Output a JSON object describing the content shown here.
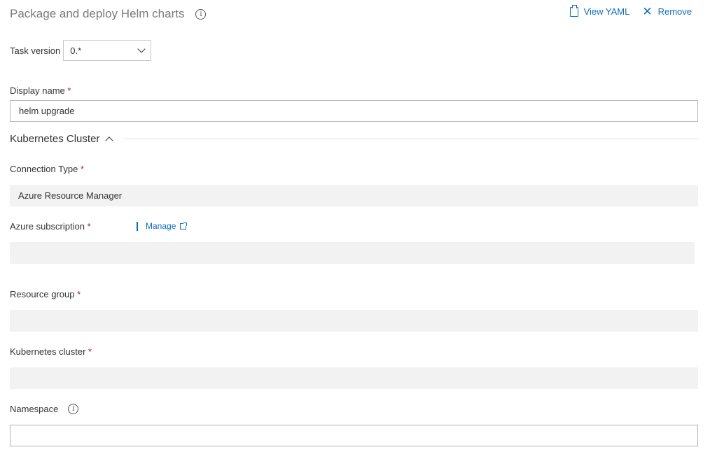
{
  "header": {
    "title": "Package and deploy Helm charts",
    "actions": {
      "view_yaml": "View YAML",
      "remove": "Remove"
    }
  },
  "task_version": {
    "label": "Task version",
    "value": "0.*"
  },
  "display_name": {
    "label": "Display name",
    "required_mark": "*",
    "value": "helm upgrade"
  },
  "kubernetes_section": {
    "title": "Kubernetes Cluster"
  },
  "connection_type": {
    "label": "Connection Type",
    "required_mark": "*",
    "value": "Azure Resource Manager"
  },
  "azure_subscription": {
    "label": "Azure subscription",
    "required_mark": "*",
    "manage": "Manage",
    "value": ""
  },
  "resource_group": {
    "label": "Resource group",
    "required_mark": "*",
    "value": ""
  },
  "kubernetes_cluster": {
    "label": "Kubernetes cluster",
    "required_mark": "*",
    "value": ""
  },
  "namespace": {
    "label": "Namespace",
    "value": ""
  },
  "colors": {
    "accent": "#106ebe",
    "required": "#a4262c",
    "disabled_field": "#f2f2f2"
  }
}
